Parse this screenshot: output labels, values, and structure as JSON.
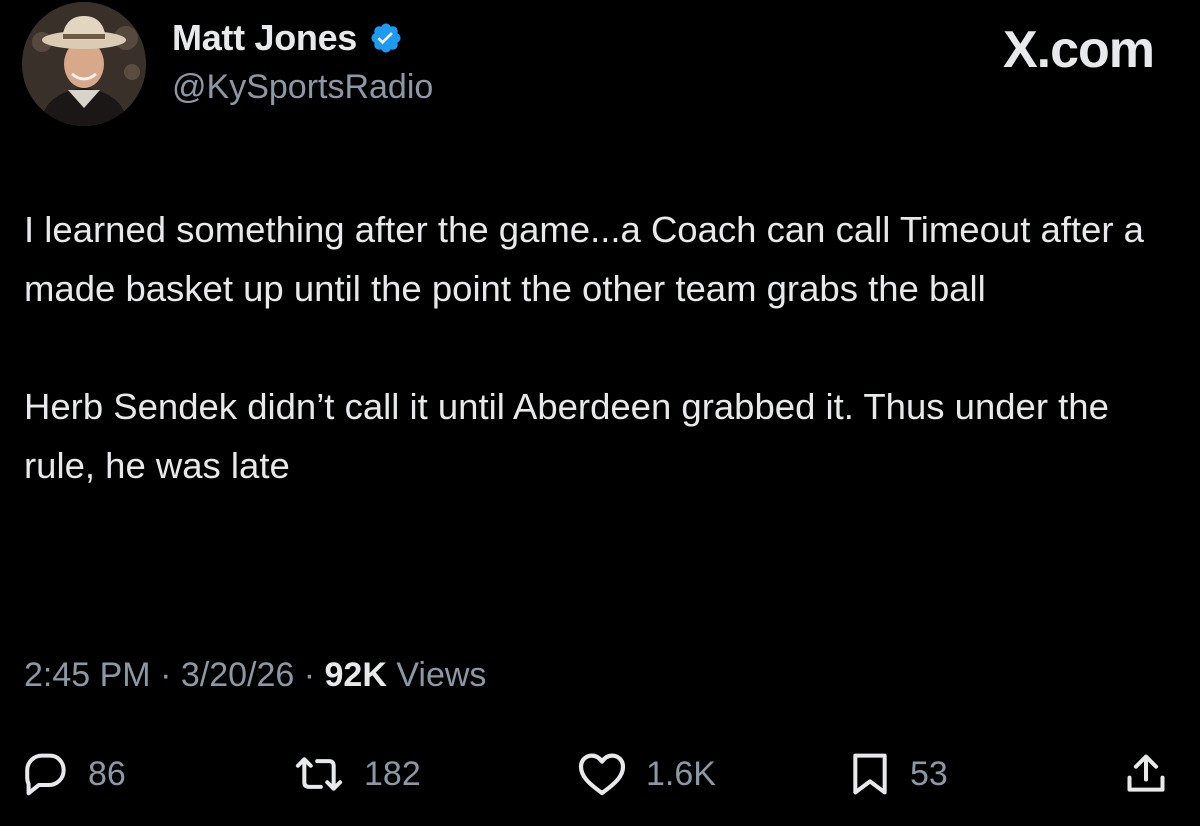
{
  "author": {
    "display_name": "Matt Jones",
    "handle": "@KySportsRadio",
    "verified": true,
    "verified_color": "#1d9bf0"
  },
  "brand": "X.com",
  "tweet": {
    "paragraphs": [
      "I learned something after the game...a Coach can call Timeout after a made basket up until the point the other team grabs the ball",
      "Herb Sendek didn’t call it until Aberdeen grabbed it. Thus under the rule, he was late"
    ]
  },
  "meta": {
    "time": "2:45 PM",
    "separator": " · ",
    "date": "3/20/26",
    "views_count": "92K",
    "views_label": "Views"
  },
  "actions": {
    "reply": {
      "icon": "reply-icon",
      "count": "86"
    },
    "repost": {
      "icon": "repost-icon",
      "count": "182"
    },
    "like": {
      "icon": "heart-icon",
      "count": "1.6K"
    },
    "bookmark": {
      "icon": "bookmark-icon",
      "count": "53"
    },
    "share": {
      "icon": "share-icon"
    }
  },
  "colors": {
    "background": "#000000",
    "text": "#e7e9ea",
    "muted": "#8b98a5"
  }
}
